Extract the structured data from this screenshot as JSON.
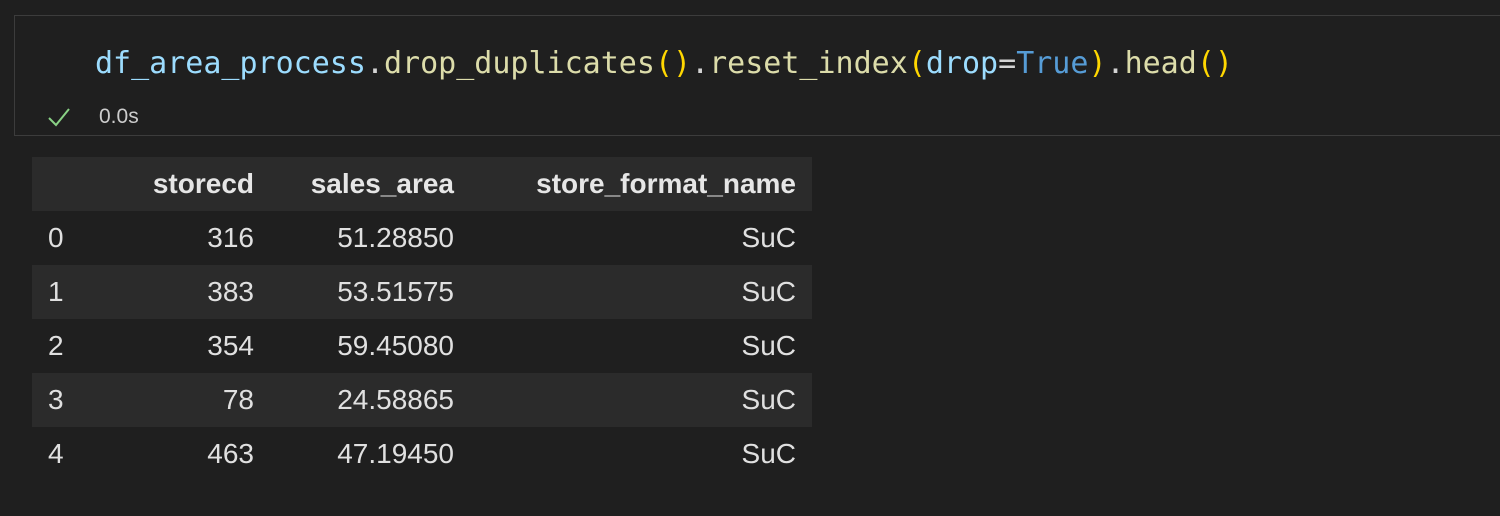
{
  "cell": {
    "code": {
      "object": "df_area_process",
      "dot1": ".",
      "method1": "drop_duplicates",
      "paren_open1": "(",
      "paren_close1": ")",
      "dot2": ".",
      "method2": "reset_index",
      "paren_open2": "(",
      "param": "drop",
      "equals": "=",
      "value": "True",
      "paren_close2": ")",
      "dot3": ".",
      "method3": "head",
      "paren_open3": "(",
      "paren_close3": ")"
    },
    "status": {
      "icon": "check-icon",
      "icon_color": "#89d185",
      "exec_time": "0.0s"
    }
  },
  "output_table": {
    "columns": [
      "",
      "storecd",
      "sales_area",
      "store_format_name"
    ],
    "rows": [
      [
        "0",
        "316",
        "51.28850",
        "SuC"
      ],
      [
        "1",
        "383",
        "53.51575",
        "SuC"
      ],
      [
        "2",
        "354",
        "59.45080",
        "SuC"
      ],
      [
        "3",
        "78",
        "24.58865",
        "SuC"
      ],
      [
        "4",
        "463",
        "47.19450",
        "SuC"
      ]
    ]
  }
}
